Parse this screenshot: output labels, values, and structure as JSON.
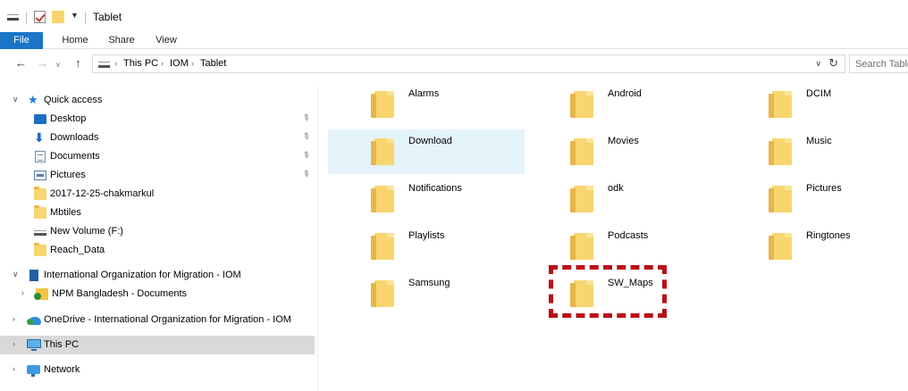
{
  "window": {
    "title": "Tablet"
  },
  "ribbon": {
    "tabs": [
      "File",
      "Home",
      "Share",
      "View"
    ]
  },
  "address": {
    "crumbs": [
      "This PC",
      "IOM",
      "Tablet"
    ],
    "search_placeholder": "Search Tablet"
  },
  "nav": {
    "quick_access": "Quick access",
    "items": [
      {
        "label": "Desktop",
        "icon": "desktop-icon",
        "pinned": true
      },
      {
        "label": "Downloads",
        "icon": "downloads-icon",
        "pinned": true
      },
      {
        "label": "Documents",
        "icon": "documents-icon",
        "pinned": true
      },
      {
        "label": "Pictures",
        "icon": "pictures-icon",
        "pinned": true
      },
      {
        "label": "2017-12-25-chakmarkul",
        "icon": "folder-icon"
      },
      {
        "label": "Mbtiles",
        "icon": "folder-icon"
      },
      {
        "label": "New Volume (F:)",
        "icon": "drive-icon"
      },
      {
        "label": "Reach_Data",
        "icon": "folder-icon"
      }
    ],
    "org": "International Organization for Migration - IOM",
    "npm": "NPM Bangladesh - Documents",
    "onedrive": "OneDrive - International Organization for Migration - IOM",
    "this_pc": "This PC",
    "network": "Network"
  },
  "folders": [
    {
      "label": "Alarms"
    },
    {
      "label": "Android"
    },
    {
      "label": "DCIM"
    },
    {
      "label": "Download",
      "selected": true
    },
    {
      "label": "Movies"
    },
    {
      "label": "Music"
    },
    {
      "label": "Notifications"
    },
    {
      "label": "odk"
    },
    {
      "label": "Pictures"
    },
    {
      "label": "Playlists"
    },
    {
      "label": "Podcasts"
    },
    {
      "label": "Ringtones"
    },
    {
      "label": "Samsung"
    },
    {
      "label": "SW_Maps",
      "highlighted": true
    }
  ],
  "colors": {
    "accent": "#1a75c7",
    "folder": "#f8d56e",
    "selection": "#e5f3fb",
    "annotation": "#b80f17"
  }
}
